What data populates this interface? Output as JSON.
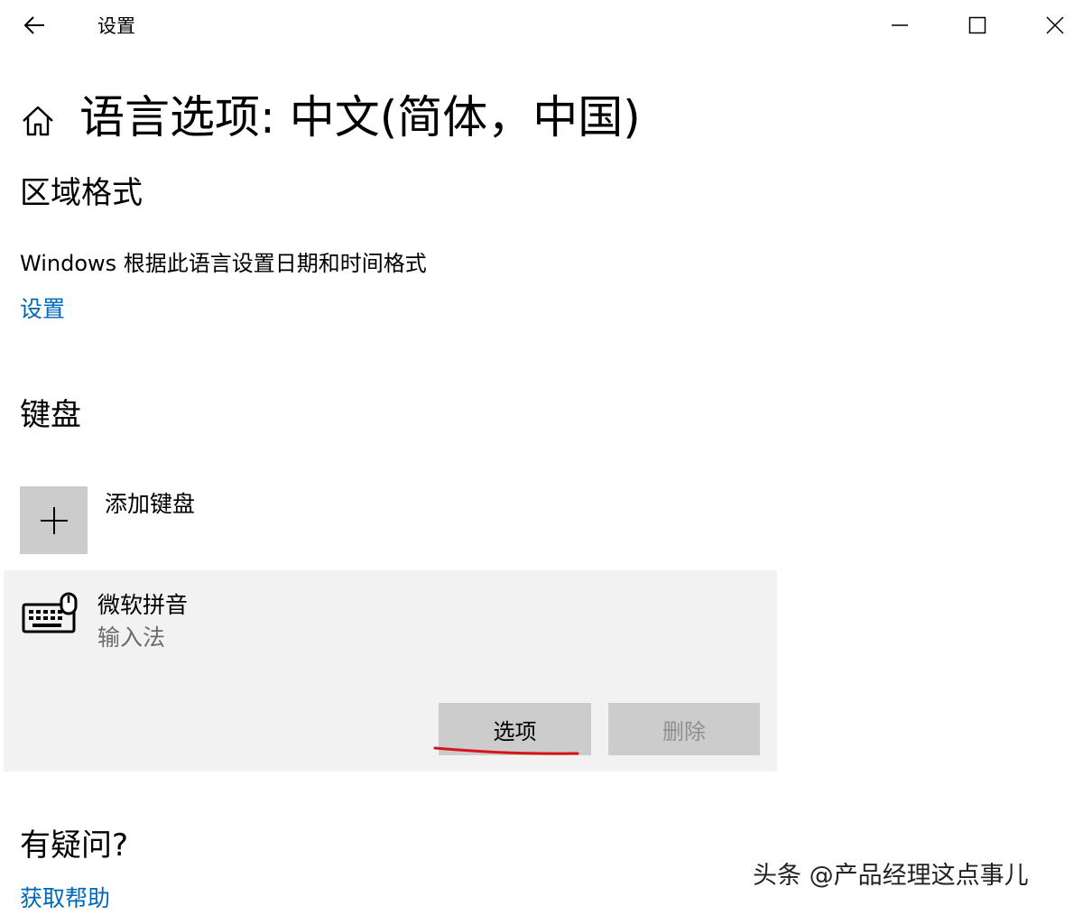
{
  "window": {
    "title": "设置",
    "back_icon": "back-arrow-icon",
    "minimize_icon": "minimize-icon",
    "maximize_icon": "maximize-icon",
    "close_icon": "close-icon"
  },
  "header": {
    "home_icon": "home-icon",
    "title": "语言选项: 中文(简体，中国)"
  },
  "regional_format": {
    "heading": "区域格式",
    "description": "Windows 根据此语言设置日期和时间格式",
    "link": "设置"
  },
  "keyboards": {
    "heading": "键盘",
    "add_icon": "plus-icon",
    "add_label": "添加键盘",
    "items": [
      {
        "icon": "keyboard-icon",
        "name": "微软拼音",
        "subtitle": "输入法",
        "options_label": "选项",
        "remove_label": "删除"
      }
    ]
  },
  "help": {
    "heading": "有疑问?",
    "link": "获取帮助"
  },
  "watermark": "头条 @产品经理这点事儿",
  "colors": {
    "link": "#0067b8",
    "panel_bg": "#f2f2f2",
    "button_bg": "#cccccc",
    "annotation_red": "#d7141a"
  }
}
